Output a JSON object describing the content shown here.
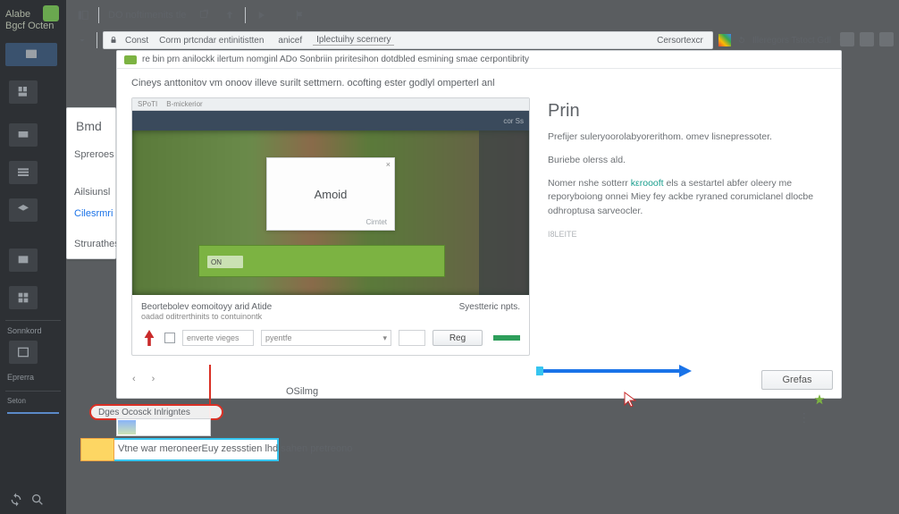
{
  "brand": {
    "line1": "Alabe",
    "line2": "Bgcf Octen"
  },
  "sidebar": {
    "labels": [
      "Sonnkord",
      "Eprerra",
      "Seton"
    ]
  },
  "toolbar": {
    "title": "DO noftimenits tle"
  },
  "address": {
    "seg1": "Const",
    "seg2": "Corm prtcndar entinitistten",
    "seg3": "anicef",
    "seg4": "Iplectuihy scernery",
    "crumb": "Cersortexcr",
    "right": "Illeregors Tstoct Gdl"
  },
  "infobar": "re bin prn anilockk ilertum nomginl ADo Sonbriin priritesihon  dotdbled esmining smae cerpontibrity",
  "paragraph": "Cineys anttonitov vm onoov illeve surilt settmern. ocofting ester godlyl omperterl anl",
  "card": {
    "subhead": "B-mickerior",
    "thumb_tab": "cor Ss",
    "dialog_title": "Amoid",
    "dialog_sub": "Cirntet",
    "ok": "ON",
    "foot_title": "Beortebolev eomoitoyy arid Atide",
    "foot_sub": "oadad oditrerthinits to contuinontk",
    "foot_right": "Syestteric npts.",
    "chk_label": "enverte vieges",
    "sel_label": "pyentfe",
    "reg": "Reg"
  },
  "right": {
    "title": "Prin",
    "p1": "Prefijer suleryoorolabyorerithom. omev lisnepressoter.",
    "p2": "Buriebe olerss ald.",
    "p3a": "Nomer nshe sotterr",
    "p3link": "kεroooft",
    "p3b": "els a sestartel abfer oleery me reporyboiong onnei Miey fey ackbe ryraned corumiclanel dloсbe odhroptusa sarveocler.",
    "small": "I8LEITE"
  },
  "center_label": "OSilmg",
  "button": "Grefas",
  "annotation": "Dges  Ocosck Inlrigntes",
  "highlight": "Vtne war meroneerEuy zessstien lhd sahen pretreono",
  "sidepanel": {
    "head": "Bmd",
    "items": [
      "Spreroes",
      "Ailsiunsl",
      "Cilesrmri",
      "Strurathes"
    ]
  }
}
